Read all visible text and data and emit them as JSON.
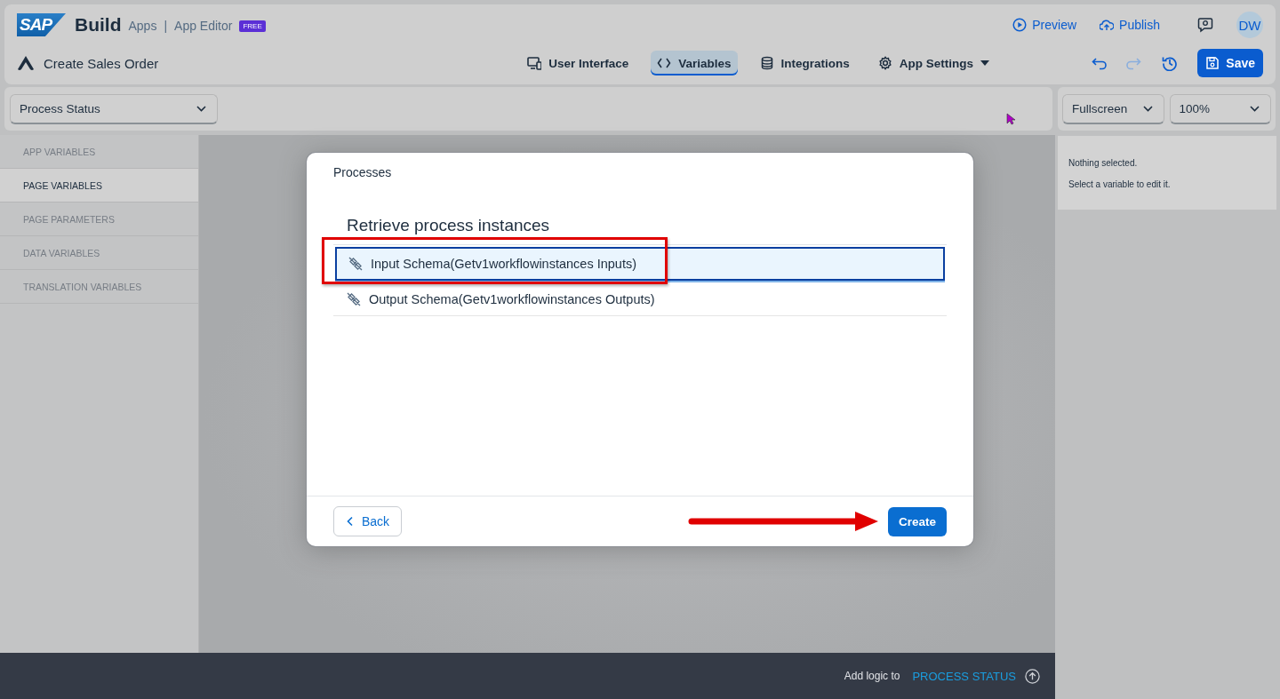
{
  "header": {
    "logo": "SAP",
    "product": "Build",
    "breadcrumb": [
      "Apps",
      "|",
      "App Editor"
    ],
    "badge": "FREE",
    "actions": [
      {
        "kind": "preview",
        "label": "Preview"
      },
      {
        "kind": "publish",
        "label": "Publish"
      }
    ],
    "avatar": "DW"
  },
  "app": {
    "title": "Create Sales Order"
  },
  "tabs": [
    {
      "kind": "ui",
      "label": "User Interface",
      "selected": false
    },
    {
      "kind": "variables",
      "label": "Variables",
      "selected": true
    },
    {
      "kind": "integrations",
      "label": "Integrations",
      "selected": false
    },
    {
      "kind": "settings",
      "label": "App Settings",
      "selected": false
    }
  ],
  "tools": [
    {
      "kind": "undo",
      "disabled": false
    },
    {
      "kind": "redo",
      "disabled": true
    },
    {
      "kind": "history",
      "disabled": false
    }
  ],
  "save": "Save",
  "page_select": {
    "value": "Process Status"
  },
  "view_selects": [
    {
      "value": "Fullscreen"
    },
    {
      "value": "100%"
    }
  ],
  "sidebar": {
    "items": [
      {
        "label": "APP VARIABLES",
        "selected": false
      },
      {
        "label": "PAGE VARIABLES",
        "selected": true
      },
      {
        "label": "PAGE PARAMETERS",
        "selected": false
      },
      {
        "label": "DATA VARIABLES",
        "selected": false
      },
      {
        "label": "TRANSLATION VARIABLES",
        "selected": false
      }
    ]
  },
  "details": {
    "lines": [
      "Nothing selected.",
      "Select a variable to edit it."
    ]
  },
  "dialog": {
    "title": "Processes",
    "heading": "Retrieve process instances",
    "items": [
      {
        "label": "Input Schema(Getv1workflowinstances Inputs)",
        "selected": true
      },
      {
        "label": "Output Schema(Getv1workflowinstances Outputs)",
        "selected": false
      }
    ],
    "back": "Back",
    "create": "Create"
  },
  "logic_bar": {
    "label": "Add logic to",
    "target": "PROCESS STATUS"
  },
  "annotations": {
    "highlight_box": true,
    "arrow": true
  }
}
